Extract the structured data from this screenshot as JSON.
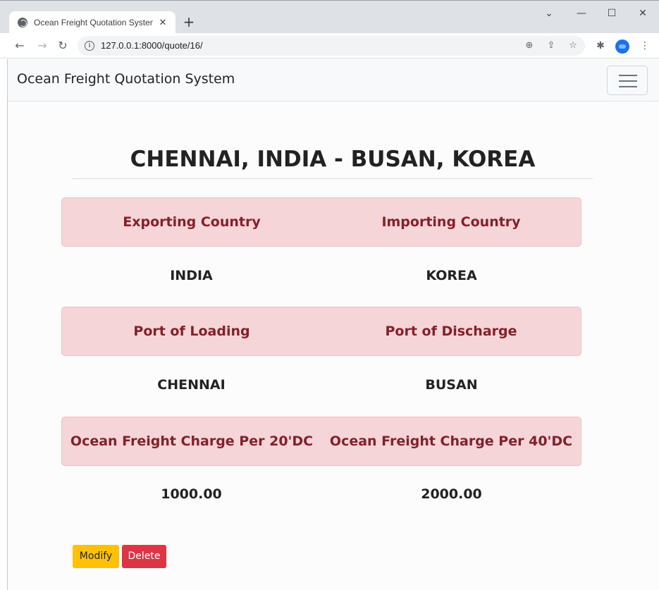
{
  "browser": {
    "tab_title": "Ocean Freight Quotation System",
    "tab_close": "✕",
    "new_tab": "+",
    "url": "127.0.0.1:8000/quote/16/"
  },
  "navbar": {
    "brand": "Ocean Freight Quotation System"
  },
  "quote": {
    "title": "CHENNAI, INDIA - BUSAN, KOREA",
    "rows": [
      {
        "left_label": "Exporting Country",
        "right_label": "Importing Country",
        "left_value": "INDIA",
        "right_value": "KOREA"
      },
      {
        "left_label": "Port of Loading",
        "right_label": "Port of Discharge",
        "left_value": "CHENNAI",
        "right_value": "BUSAN"
      },
      {
        "left_label": "Ocean Freight Charge Per 20'DC",
        "right_label": "Ocean Freight Charge Per 40'DC",
        "left_value": "1000.00",
        "right_value": "2000.00"
      }
    ]
  },
  "actions": {
    "modify_label": "Modify",
    "delete_label": "Delete"
  },
  "colors": {
    "alert_bg": "#f5d5d8",
    "alert_text": "#842029",
    "modify_btn": "#ffc107",
    "delete_btn": "#dc3545"
  }
}
